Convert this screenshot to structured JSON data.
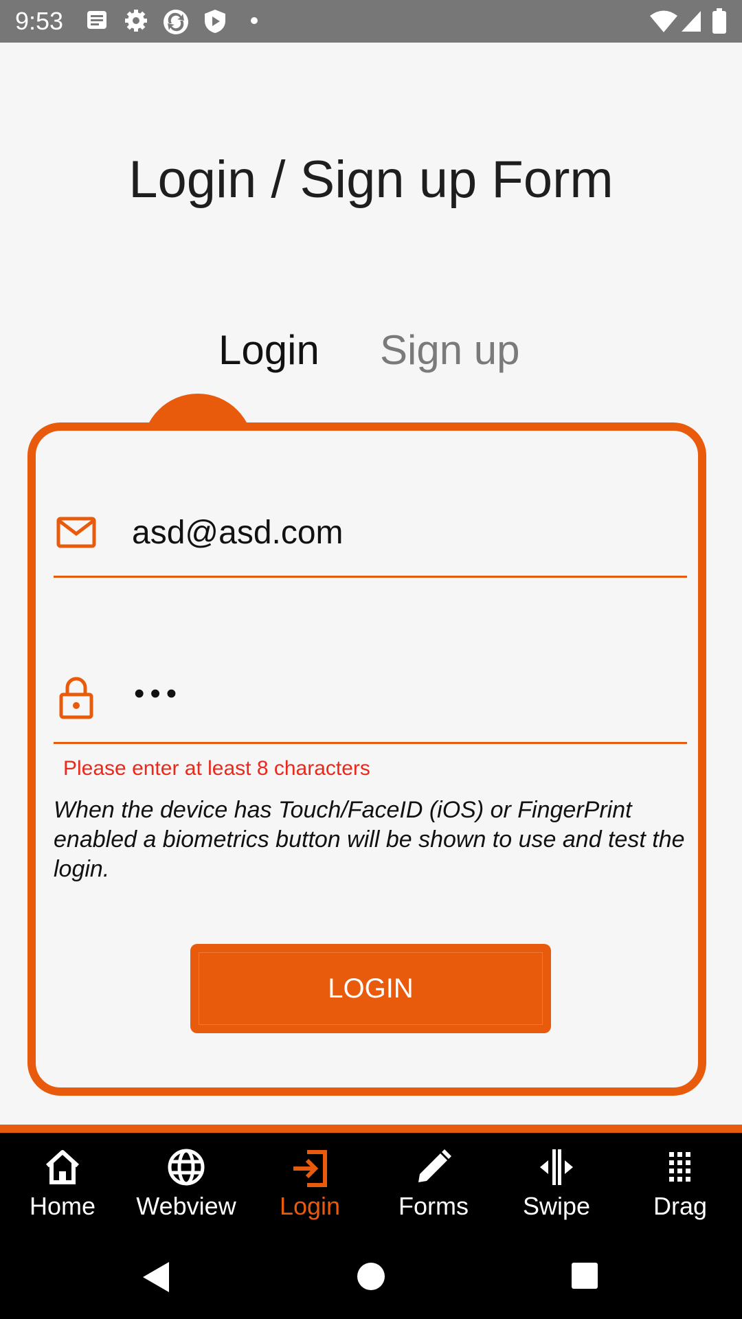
{
  "status_bar": {
    "time": "9:53",
    "left_icons": [
      "notes-icon",
      "settings-gear-icon",
      "sync-icon",
      "shield-play-icon",
      "dot-icon"
    ],
    "right_icons": [
      "wifi-icon",
      "cellular-signal-icon",
      "battery-icon"
    ]
  },
  "page": {
    "title": "Login / Sign up Form"
  },
  "tabs": {
    "login": "Login",
    "signup": "Sign up",
    "active": "login"
  },
  "form": {
    "email": {
      "value": "asd@asd.com",
      "icon": "mail-icon"
    },
    "password": {
      "value": "•••",
      "icon": "lock-icon"
    },
    "error": "Please enter at least 8 characters",
    "hint": "When the device has Touch/FaceID (iOS) or FingerPrint enabled a biometrics button will be shown to use and test the login.",
    "submit": "LOGIN"
  },
  "bottom_nav": {
    "items": [
      {
        "label": "Home",
        "icon": "home-icon"
      },
      {
        "label": "Webview",
        "icon": "globe-icon"
      },
      {
        "label": "Login",
        "icon": "login-icon",
        "active": true
      },
      {
        "label": "Forms",
        "icon": "pencil-icon"
      },
      {
        "label": "Swipe",
        "icon": "swipe-icon"
      },
      {
        "label": "Drag",
        "icon": "grid-dots-icon"
      }
    ]
  },
  "system_nav": [
    "back-icon",
    "home-circle-icon",
    "recents-square-icon"
  ],
  "colors": {
    "accent": "#e95b0c",
    "error": "#e8291c",
    "background": "#f6f6f6"
  }
}
